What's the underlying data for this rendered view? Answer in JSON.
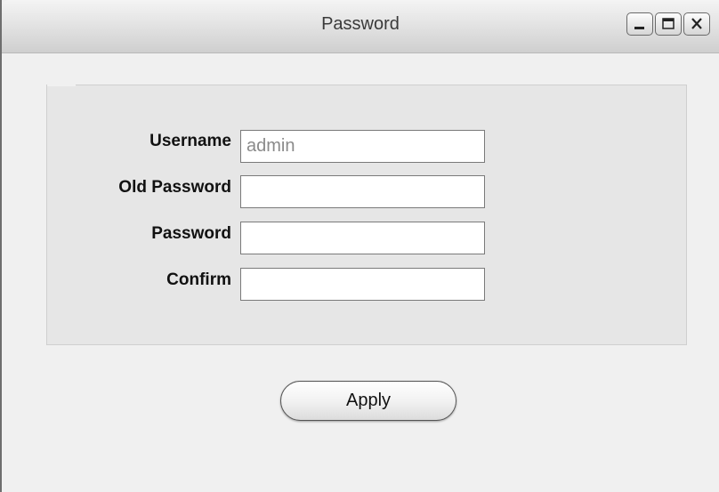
{
  "window": {
    "title": "Password",
    "controls": [
      "minimize-icon",
      "maximize-icon",
      "close-icon"
    ]
  },
  "form": {
    "fields": [
      {
        "label": "Username",
        "value": "admin",
        "placeholder": ""
      },
      {
        "label": "Old Password",
        "value": "",
        "placeholder": ""
      },
      {
        "label": "Password",
        "value": "",
        "placeholder": ""
      },
      {
        "label": "Confirm",
        "value": "",
        "placeholder": ""
      }
    ],
    "apply_label": "Apply"
  }
}
